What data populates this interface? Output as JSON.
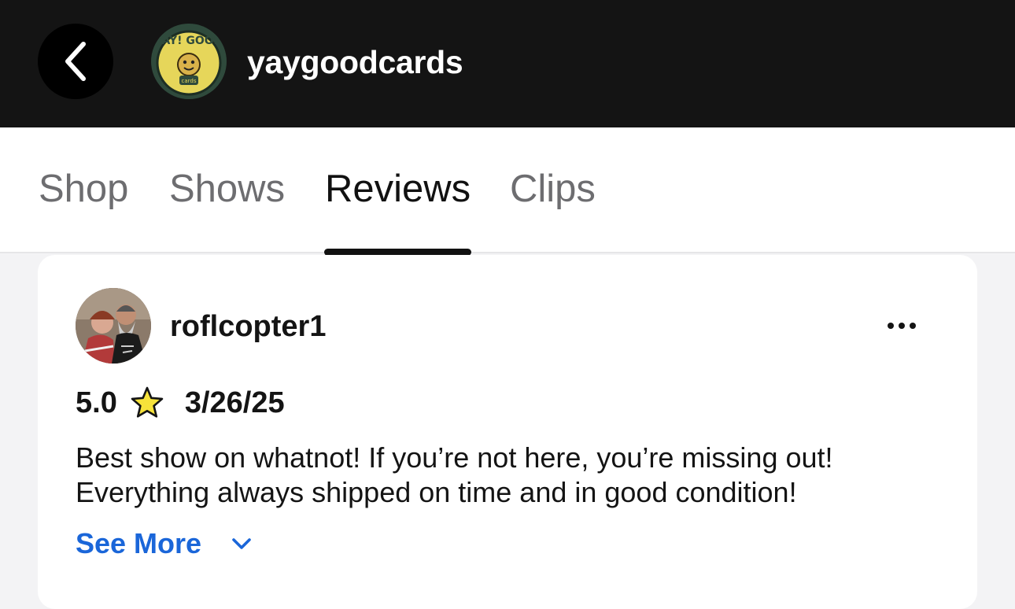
{
  "header": {
    "store_name": "yaygoodcards",
    "avatar_text": "YAY! GOOD",
    "avatar_subtext": "cards"
  },
  "tabs": [
    {
      "label": "Shop",
      "active": false
    },
    {
      "label": "Shows",
      "active": false
    },
    {
      "label": "Reviews",
      "active": true
    },
    {
      "label": "Clips",
      "active": false
    }
  ],
  "review": {
    "username": "roflcopter1",
    "rating": "5.0",
    "date": "3/26/25",
    "text_line1": "Best show on whatnot! If you’re not here, you’re missing out!",
    "text_line2": "Everything always shipped on time and in good condition!",
    "see_more_label": "See More"
  },
  "colors": {
    "header_bg": "#141414",
    "active_tab": "#111111",
    "inactive_tab": "#6d6d70",
    "link": "#1a66d9",
    "star_fill": "#f6e23a"
  },
  "icons": {
    "back": "chevron-left-icon",
    "more": "more-horizontal-icon",
    "star": "star-icon",
    "expand": "chevron-down-icon"
  }
}
